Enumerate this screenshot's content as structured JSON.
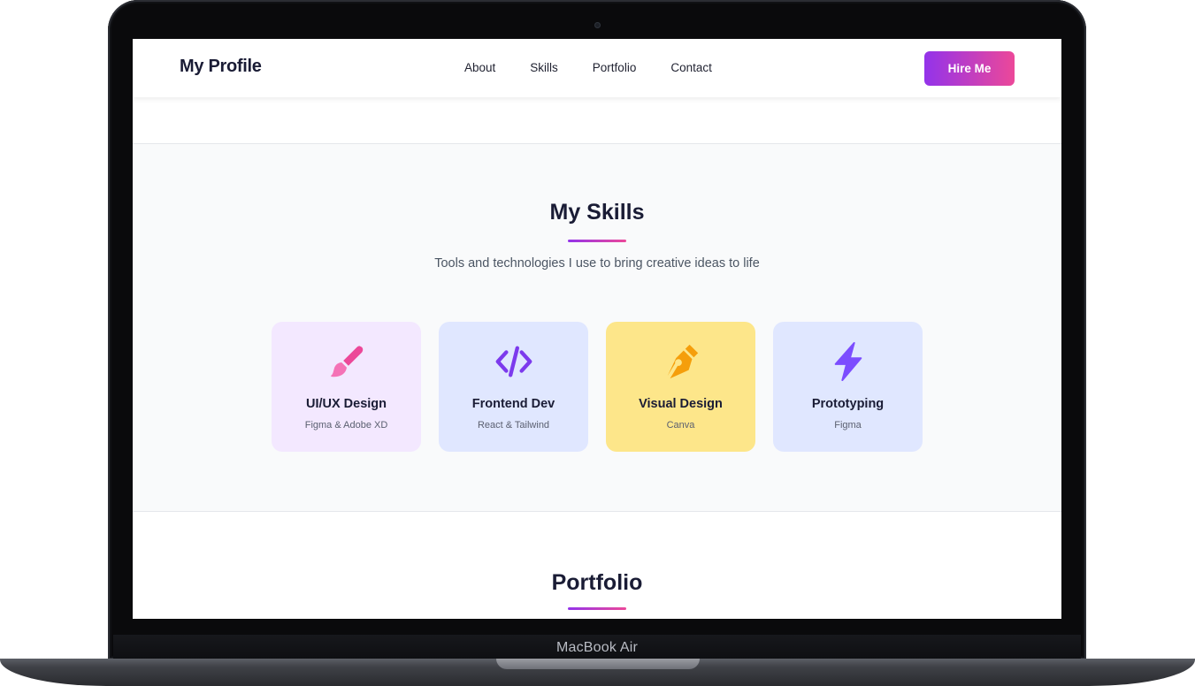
{
  "device": {
    "label": "MacBook Air"
  },
  "navbar": {
    "brand": "My Profile",
    "links": [
      "About",
      "Skills",
      "Portfolio",
      "Contact"
    ],
    "cta_label": "Hire Me"
  },
  "skills": {
    "title": "My Skills",
    "subtitle": "Tools and technologies I use to bring creative ideas to life",
    "cards": [
      {
        "title": "UI/UX Design",
        "tools": "Figma & Adobe XD",
        "icon": "paintbrush-icon",
        "bg": "#f3e8ff",
        "icon_color": "#ec4899"
      },
      {
        "title": "Frontend Dev",
        "tools": "React & Tailwind",
        "icon": "code-icon",
        "bg": "#e0e7ff",
        "icon_color": "#7c3aed"
      },
      {
        "title": "Visual Design",
        "tools": "Canva",
        "icon": "pen-nib-icon",
        "bg": "#fde68a",
        "icon_color": "#f59e0b"
      },
      {
        "title": "Prototyping",
        "tools": "Figma",
        "icon": "lightning-icon",
        "bg": "#e0e7ff",
        "icon_color": "#7c4dff"
      }
    ]
  },
  "portfolio": {
    "title": "Portfolio"
  },
  "colors": {
    "accent_start": "#9333ea",
    "accent_end": "#ec4899",
    "heading": "#1a1c35"
  }
}
